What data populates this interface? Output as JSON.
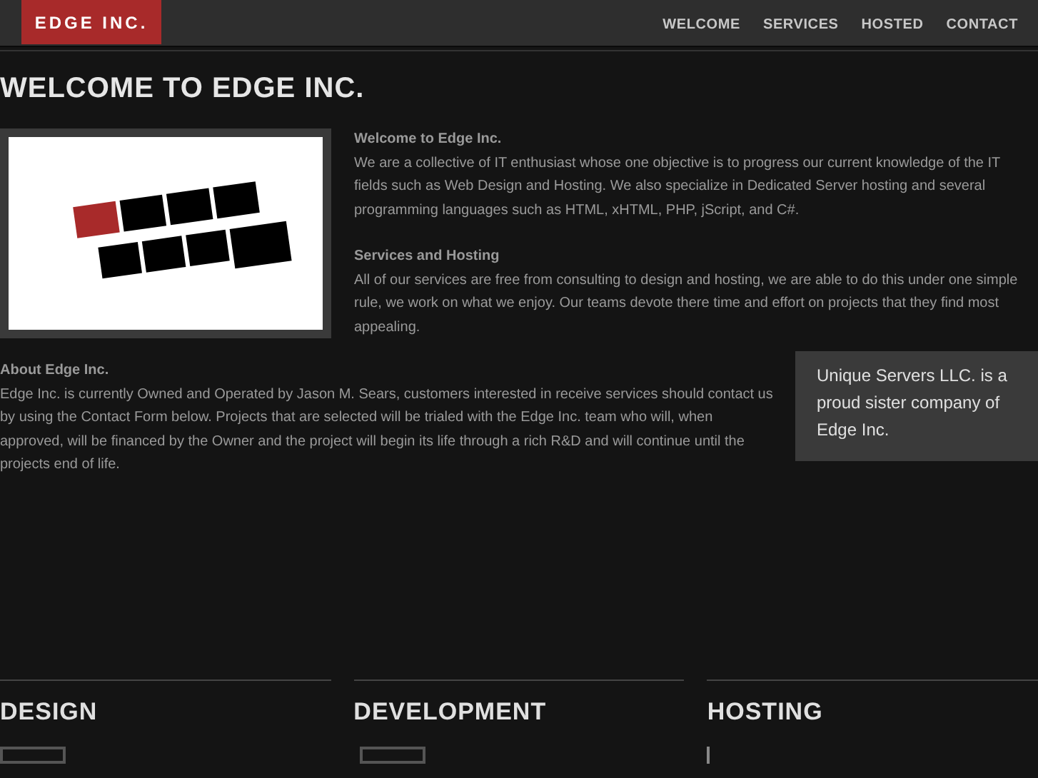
{
  "header": {
    "logo": "EDGE INC.",
    "nav": [
      {
        "label": "WELCOME"
      },
      {
        "label": "SERVICES"
      },
      {
        "label": "HOSTED"
      },
      {
        "label": "CONTACT"
      }
    ]
  },
  "page_title": "WELCOME TO EDGE INC.",
  "intro_sections": [
    {
      "heading": "Welcome to Edge Inc.",
      "body": "We are a collective of IT enthusiast whose one objective is to progress our current knowledge of the IT fields such as Web Design and Hosting. We also specialize in Dedicated Server hosting and several programming languages such as HTML, xHTML, PHP, jScript, and C#."
    },
    {
      "heading": "Services and Hosting",
      "body": "All of our services are free from consulting to design and hosting, we are able to do this under one simple rule, we work on what we enjoy. Our teams devote there time and effort on projects that they find most appealing."
    }
  ],
  "about": {
    "heading": "About Edge Inc.",
    "body": "Edge Inc. is currently Owned and Operated by Jason M. Sears, customers interested in receive services should contact us by using the Contact Form below. Projects that are selected will be trialed with the Edge Inc. team who will, when approved, will be financed by the Owner and the project will begin its life through a rich R&D and will continue until the projects end of life."
  },
  "sister_note": "Unique Servers LLC. is a proud sister company of Edge Inc.",
  "columns": [
    {
      "heading": "DESIGN"
    },
    {
      "heading": "DEVELOPMENT"
    },
    {
      "heading": "HOSTING"
    }
  ]
}
